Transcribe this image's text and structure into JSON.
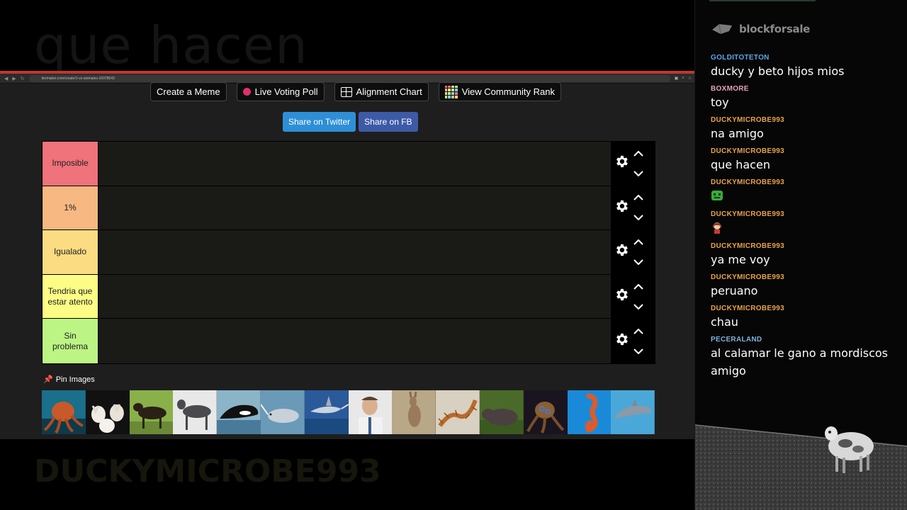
{
  "overlay": {
    "top_text": "que hacen",
    "bottom_text": "DUCKYMICROBE993"
  },
  "browser": {
    "url": "tiermaker.com/create/1-vs-animales-16978543",
    "toolbar": {
      "create_meme": "Create a Meme",
      "live_poll": "Live Voting Poll",
      "alignment_chart": "Alignment Chart",
      "community_rank": "View Community Rank"
    },
    "share": {
      "twitter": "Share on Twitter",
      "facebook": "Share on FB"
    },
    "tiers": [
      {
        "label": "Imposible",
        "color": "#f0727a"
      },
      {
        "label": "1%",
        "color": "#f7b882"
      },
      {
        "label": "Igualado",
        "color": "#fbdc83"
      },
      {
        "label": "Tendria que estar atento",
        "color": "#fdfd86"
      },
      {
        "label": "Sin problema",
        "color": "#bdf584"
      }
    ],
    "pin_images_label": "Pin Images",
    "images": [
      "octopus",
      "chihuahuas",
      "rottweiler",
      "great-dane",
      "orca",
      "narwhal",
      "swordfish",
      "man",
      "kangaroo",
      "centipede",
      "hippo",
      "blue-ringed-octopus",
      "seahorse",
      "dolphin"
    ]
  },
  "chat": {
    "brand": "blockforsale",
    "messages": [
      {
        "user": "GOLDITOTETON",
        "user_color": "#5aa9e6",
        "text": "ducky y beto hijos mios"
      },
      {
        "user": "BOXMORE",
        "user_color": "#e8a0c0",
        "text": "toy"
      },
      {
        "user": "DUCKYMICROBE993",
        "user_color": "#e8a34a",
        "text": "na amigo"
      },
      {
        "user": "DUCKYMICROBE993",
        "user_color": "#e8a34a",
        "text": "que hacen"
      },
      {
        "user": "DUCKYMICROBE993",
        "user_color": "#e8a34a",
        "emote": "green-face-emote"
      },
      {
        "user": "DUCKYMICROBE993",
        "user_color": "#e8a34a",
        "emote": "character-emote"
      },
      {
        "user": "DUCKYMICROBE993",
        "user_color": "#e8a34a",
        "text": "ya me voy"
      },
      {
        "user": "DUCKYMICROBE993",
        "user_color": "#e8a34a",
        "text": "peruano"
      },
      {
        "user": "DUCKYMICROBE993",
        "user_color": "#e8a34a",
        "text": "chau"
      },
      {
        "user": "PECERALAND",
        "user_color": "#7fb3d9",
        "text": "al calamar le gano a mordiscos amigo"
      }
    ]
  }
}
